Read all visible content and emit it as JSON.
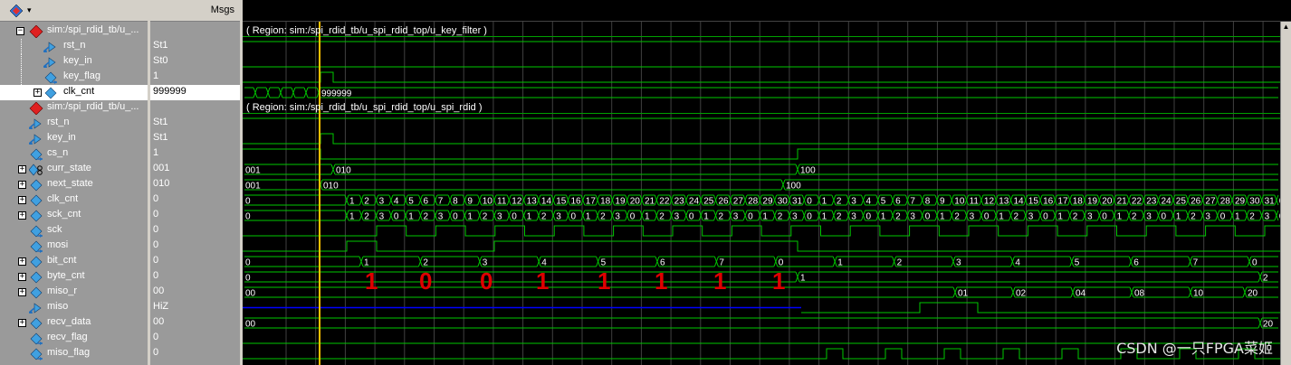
{
  "header": {
    "msgs_label": "Msgs"
  },
  "colors": {
    "wave_green": "#00c800",
    "cursor_yellow": "#ffc000",
    "hiz_blue": "#0000ff",
    "annotation_red": "#e00000",
    "text_white": "#ffffff"
  },
  "groups": [
    {
      "region": "( Region: sim:/spi_rdid_tb/u_spi_rdid_top/u_key_filter )"
    },
    {
      "region": "( Region: sim:/spi_rdid_tb/u_spi_rdid_top/u_spi_rdid )"
    }
  ],
  "signals": [
    {
      "name": "sim:/spi_rdid_tb/u_...",
      "value": "",
      "icon": "red-diamond-icon",
      "expander": "minus"
    },
    {
      "name": "rst_n",
      "value": "St1",
      "icon": "input-arrow-icon",
      "expander": ""
    },
    {
      "name": "key_in",
      "value": "St0",
      "icon": "input-arrow-icon",
      "expander": ""
    },
    {
      "name": "key_flag",
      "value": "1",
      "icon": "output-arrow-icon",
      "expander": ""
    },
    {
      "name": "clk_cnt",
      "value": "999999",
      "icon": "blue-diamond-icon",
      "expander": "plus",
      "selected": true
    },
    {
      "name": "sim:/spi_rdid_tb/u_...",
      "value": "",
      "icon": "red-diamond-icon",
      "expander": ""
    },
    {
      "name": "rst_n",
      "value": "St1",
      "icon": "input-arrow-icon",
      "expander": ""
    },
    {
      "name": "key_in",
      "value": "St1",
      "icon": "input-arrow-icon",
      "expander": ""
    },
    {
      "name": "cs_n",
      "value": "1",
      "icon": "output-arrow-icon",
      "expander": ""
    },
    {
      "name": "curr_state",
      "value": "001",
      "icon": "state-machine-icon",
      "expander": "plus"
    },
    {
      "name": "next_state",
      "value": "010",
      "icon": "blue-diamond-icon",
      "expander": "plus"
    },
    {
      "name": "clk_cnt",
      "value": "0",
      "icon": "blue-diamond-icon",
      "expander": "plus"
    },
    {
      "name": "sck_cnt",
      "value": "0",
      "icon": "blue-diamond-icon",
      "expander": "plus"
    },
    {
      "name": "sck",
      "value": "0",
      "icon": "output-arrow-icon",
      "expander": ""
    },
    {
      "name": "mosi",
      "value": "0",
      "icon": "output-arrow-icon",
      "expander": ""
    },
    {
      "name": "bit_cnt",
      "value": "0",
      "icon": "blue-diamond-icon",
      "expander": "plus"
    },
    {
      "name": "byte_cnt",
      "value": "0",
      "icon": "blue-diamond-icon",
      "expander": "plus"
    },
    {
      "name": "miso_r",
      "value": "00",
      "icon": "blue-diamond-icon",
      "expander": "plus"
    },
    {
      "name": "miso",
      "value": "HiZ",
      "icon": "input-arrow-icon",
      "expander": ""
    },
    {
      "name": "recv_data",
      "value": "00",
      "icon": "blue-diamond-icon",
      "expander": "plus"
    },
    {
      "name": "recv_flag",
      "value": "0",
      "icon": "output-arrow-icon",
      "expander": ""
    },
    {
      "name": "miso_flag",
      "value": "0",
      "icon": "output-arrow-icon",
      "expander": ""
    }
  ],
  "wave_labels": {
    "clk_cnt_tail": "999999",
    "curr_state": [
      "001",
      "010",
      "100"
    ],
    "next_state": [
      "001",
      "010",
      "100"
    ],
    "clk_cnt_counts_a": [
      "0",
      "1",
      "2",
      "3",
      "4",
      "5",
      "6",
      "7",
      "8",
      "9",
      "10",
      "11",
      "12",
      "13",
      "14",
      "15",
      "16",
      "17",
      "18",
      "19",
      "20",
      "21",
      "22",
      "23",
      "24",
      "25",
      "26",
      "27",
      "28",
      "29",
      "30",
      "31",
      "0"
    ],
    "clk_cnt_counts_b": [
      "1",
      "2",
      "3",
      "4",
      "5",
      "6",
      "7",
      "8",
      "9",
      "10",
      "11",
      "12",
      "13",
      "14",
      "15",
      "16",
      "17",
      "18",
      "19",
      "20",
      "21",
      "22",
      "23",
      "24",
      "25",
      "26",
      "27",
      "28",
      "29",
      "30",
      "31",
      "0"
    ],
    "sck_cnt_seq": [
      "0",
      "1",
      "2",
      "3",
      "0",
      "1",
      "2",
      "3",
      "0",
      "1",
      "2",
      "3",
      "0",
      "1",
      "2",
      "3",
      "0",
      "1",
      "2",
      "3",
      "0",
      "1",
      "2",
      "3",
      "0",
      "1",
      "2",
      "3",
      "0",
      "1",
      "2",
      "3",
      "0",
      "1",
      "2",
      "3",
      "0",
      "1",
      "2",
      "3",
      "0",
      "1",
      "2",
      "3",
      "0",
      "1",
      "2",
      "3",
      "0",
      "1",
      "2",
      "3",
      "0",
      "1",
      "2",
      "3",
      "0",
      "1",
      "2",
      "3",
      "0",
      "1",
      "2",
      "3",
      "0"
    ],
    "bit_cnt": [
      "0",
      "1",
      "2",
      "3",
      "4",
      "5",
      "6",
      "7",
      "0",
      "1",
      "2",
      "3",
      "4",
      "5",
      "6",
      "7",
      "0"
    ],
    "byte_cnt": [
      "0",
      "1",
      "2"
    ],
    "miso_r": [
      "00",
      "01",
      "02",
      "04",
      "08",
      "10",
      "20"
    ],
    "recv_data": [
      "00",
      "20"
    ],
    "annotation_digits": [
      "1",
      "0",
      "0",
      "1",
      "1",
      "1",
      "1",
      "1"
    ]
  },
  "watermark": "CSDN @一只FPGA菜姬"
}
